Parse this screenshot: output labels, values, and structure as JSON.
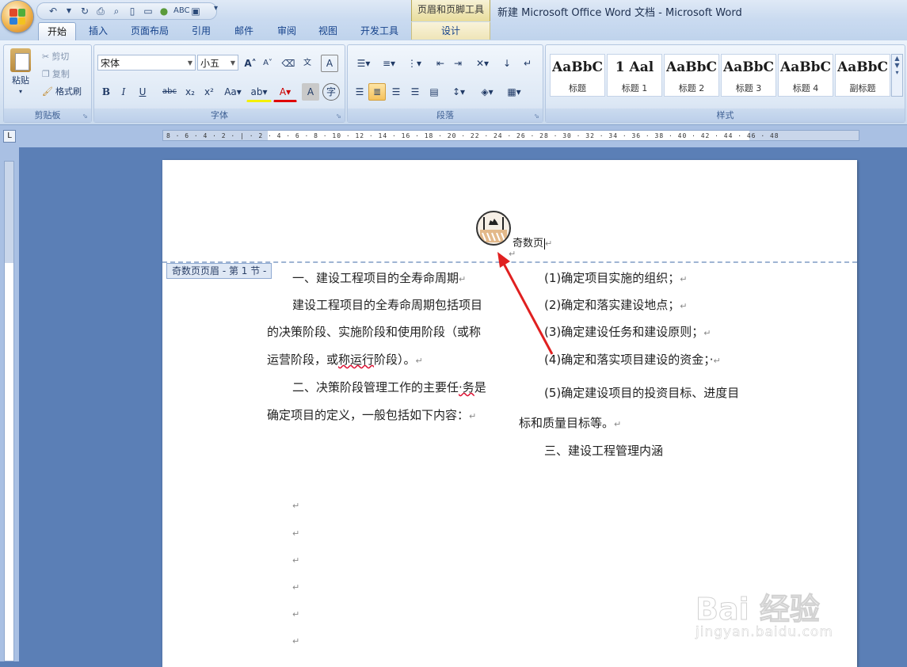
{
  "titlebar": {
    "context_tab_title": "页眉和页脚工具",
    "window_title": "新建 Microsoft Office Word 文档 - Microsoft Word"
  },
  "tabs": [
    "开始",
    "插入",
    "页面布局",
    "引用",
    "邮件",
    "审阅",
    "视图",
    "开发工具",
    "设计"
  ],
  "ribbon": {
    "clipboard": {
      "paste": "粘贴",
      "cut": "剪切",
      "copy": "复制",
      "format_painter": "格式刷",
      "label": "剪贴板"
    },
    "font": {
      "name": "宋体",
      "size": "小五",
      "label": "字体"
    },
    "paragraph": {
      "label": "段落"
    },
    "styles": {
      "label": "样式",
      "items": [
        {
          "preview": "AaBbC",
          "name": "标题"
        },
        {
          "preview": "1 Aal",
          "name": "标题 1"
        },
        {
          "preview": "AaBbCc",
          "name": "标题 2"
        },
        {
          "preview": "AaBbC",
          "name": "标题 3"
        },
        {
          "preview": "AaBbCc",
          "name": "标题 4"
        },
        {
          "preview": "AaBbC",
          "name": "副标题"
        }
      ]
    }
  },
  "ruler": {
    "h_labels": "8 · 6 · 4 · 2 · | · 2 · 4 · 6 · 8 · 10 · 12 · 14 · 16 · 18 · 20 · 22 · 24 · 26 · 28 · 30 · 32 · 34 · 36 · 38 · 40 · 42 · 44 · 46 · 48"
  },
  "document": {
    "section_tag": "奇数页页眉 - 第 1 节 -",
    "header_text": "奇数页",
    "left_col": {
      "l1": "一、建设工程项目的全寿命周期",
      "l2": "建设工程项目的全寿命周期包括项目",
      "l3": "的决策阶段、实施阶段和使用阶段（或称",
      "l4a": "运营阶段，或",
      "l4b": "称运行",
      "l4c": "阶段）。",
      "l5a": "二、决策阶段管理工作的主要任",
      "l5b": "·务",
      "l5c": "是",
      "l6": "确定项目的定义，一般包括如下内容："
    },
    "right_col": {
      "r1": "(1)确定项目实施的组织；",
      "r2": "(2)确定和落实建设地点；",
      "r3": "(3)确定建设任务和建设原则；",
      "r4": "(4)确定和落实项目建设的资金；·",
      "r5": "(5)确定建设项目的投资目标、进度目",
      "r6": "标和质量目标等。",
      "r7": "三、建设工程管理内涵"
    }
  },
  "watermark": {
    "brand": "Bai 经验",
    "url": "jingyan.baidu.com"
  },
  "colors": {
    "accent": "#15428b",
    "arrow": "#e02020"
  }
}
